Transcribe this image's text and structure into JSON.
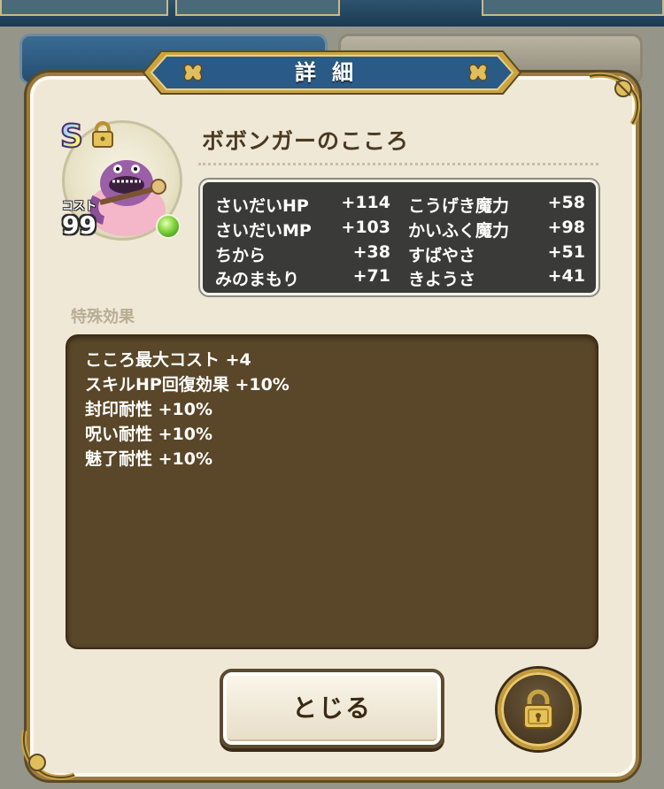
{
  "dialog": {
    "title": "詳細"
  },
  "item": {
    "rank": "S",
    "name": "ボボンガーのこころ",
    "cost_label": "コスト",
    "cost_value": "99"
  },
  "stats": [
    {
      "left_label": "さいだいHP",
      "left_value": "+114",
      "right_label": "こうげき魔力",
      "right_value": "+58"
    },
    {
      "left_label": "さいだいMP",
      "left_value": "+103",
      "right_label": "かいふく魔力",
      "right_value": "+98"
    },
    {
      "left_label": "ちから",
      "left_value": "+38",
      "right_label": "すばやさ",
      "right_value": "+51"
    },
    {
      "left_label": "みのまもり",
      "left_value": "+71",
      "right_label": "きようさ",
      "right_value": "+41"
    }
  ],
  "effects": {
    "header": "特殊効果",
    "lines": [
      "こころ最大コスト +4",
      "スキルHP回復効果 +10%",
      "封印耐性 +10%",
      "呪い耐性 +10%",
      "魅了耐性 +10%"
    ]
  },
  "buttons": {
    "close_label": "とじる",
    "lock_icon": "padlock-icon"
  },
  "colors": {
    "title_banner": "#2a5a86",
    "effects_bg": "#5a4628",
    "stats_bg": "#3a3a38",
    "panel_bg": "#efe8d6",
    "gold": "#c49a3c"
  }
}
